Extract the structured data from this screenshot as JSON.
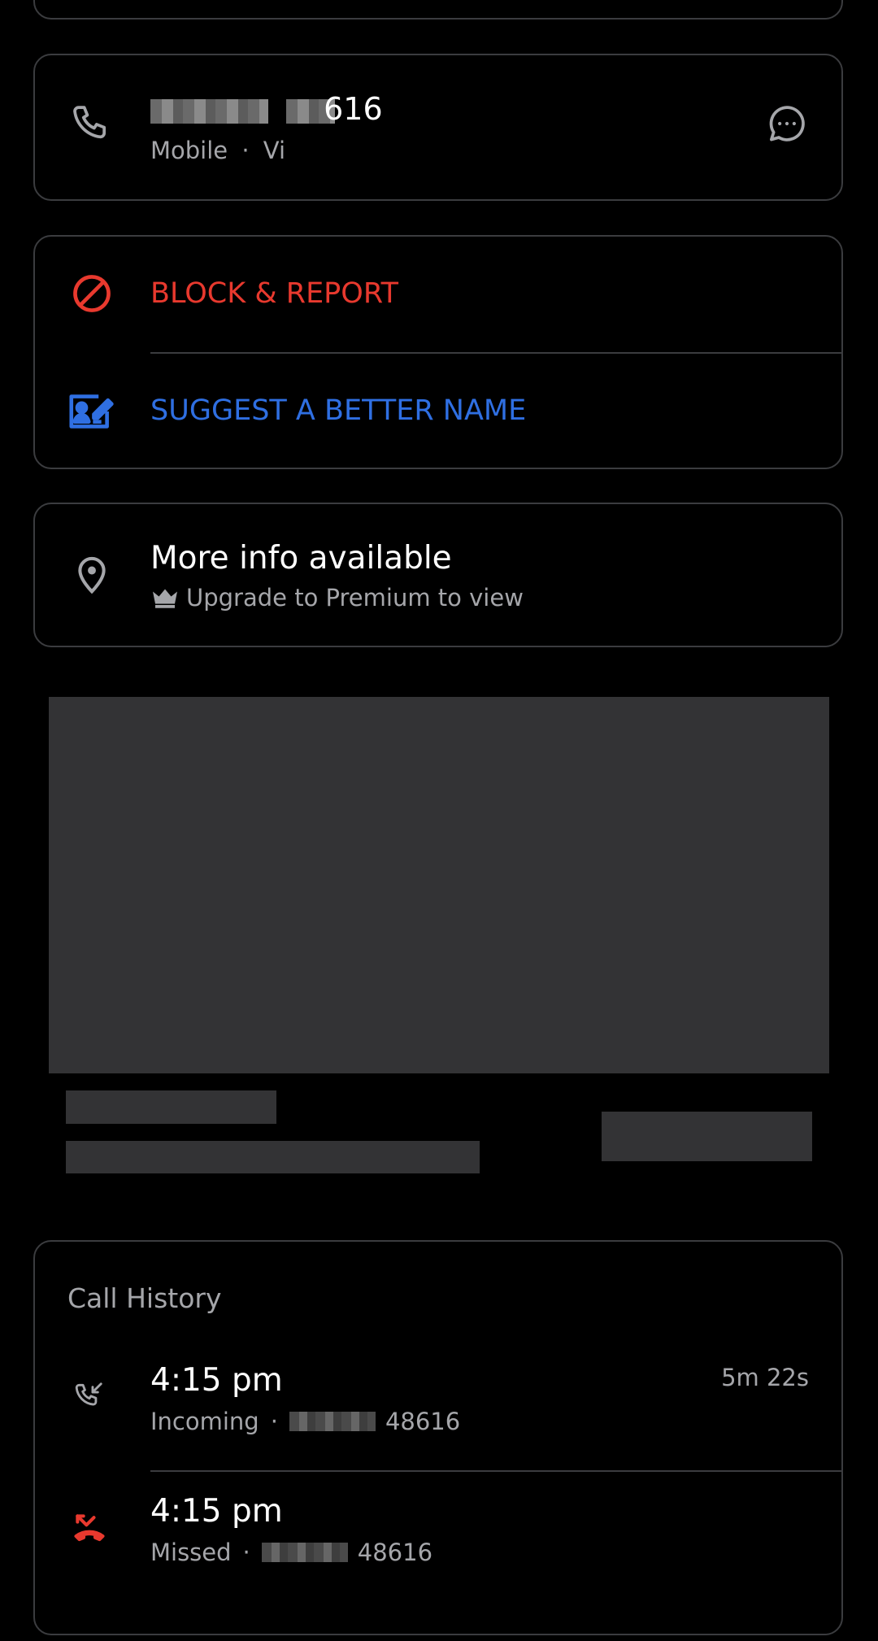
{
  "phone_card": {
    "number_suffix": "616",
    "line_type": "Mobile",
    "separator": "·",
    "carrier": "Vi"
  },
  "actions": {
    "block_report_label": "BLOCK & REPORT",
    "suggest_name_label": "SUGGEST A BETTER NAME"
  },
  "more_info": {
    "title": "More info available",
    "subtitle": "Upgrade to Premium to view"
  },
  "call_history": {
    "title": "Call History",
    "entries": [
      {
        "time": "4:15 pm",
        "type": "Incoming",
        "separator": "·",
        "number_suffix": "48616",
        "duration": "5m 22s"
      },
      {
        "time": "4:15 pm",
        "type": "Missed",
        "separator": "·",
        "number_suffix": "48616",
        "duration": ""
      }
    ]
  },
  "colors": {
    "danger": "#e8392e",
    "accent": "#2f6fe2",
    "card_border": "#3b3c3f",
    "muted_text": "#a5a6aa",
    "placeholder": "#333335"
  },
  "icons": [
    "phone-icon",
    "message-icon",
    "block-icon",
    "edit-contact-icon",
    "location-pin-icon",
    "crown-icon",
    "incoming-call-icon",
    "missed-call-icon"
  ]
}
